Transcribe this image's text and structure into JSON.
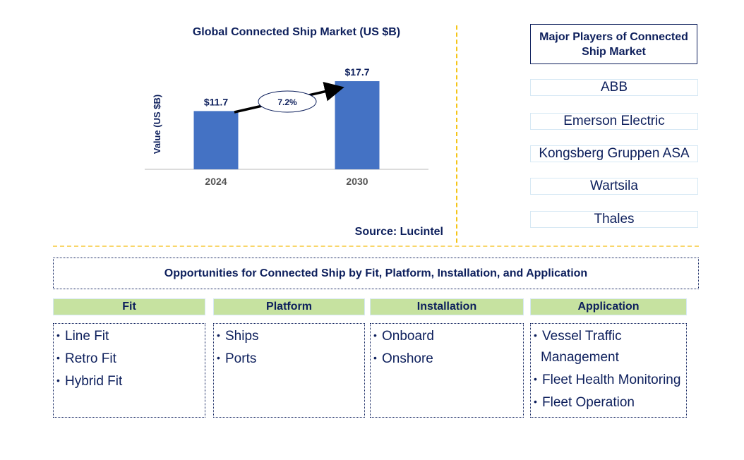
{
  "chart_data": {
    "type": "bar",
    "title": "Global Connected Ship Market (US $B)",
    "xlabel": "",
    "ylabel": "Value (US $B)",
    "categories": [
      "2024",
      "2030"
    ],
    "values": [
      11.7,
      17.7
    ],
    "data_labels": [
      "$11.7",
      "$17.7"
    ],
    "ylim": [
      0,
      20
    ],
    "grid": false,
    "bar_color": "#4472c4",
    "annotation": {
      "type": "cagr-arrow",
      "label": "7.2%",
      "from": "2024",
      "to": "2030"
    },
    "source": "Source: Lucintel"
  },
  "players": {
    "title": "Major Players of Connected Ship Market",
    "items": [
      "ABB",
      "Emerson Electric",
      "Kongsberg Gruppen ASA",
      "Wartsila",
      "Thales"
    ]
  },
  "opportunities": {
    "title": "Opportunities for Connected Ship by Fit, Platform, Installation, and Application",
    "categories": [
      {
        "name": "Fit",
        "items": [
          "Line Fit",
          "Retro Fit",
          "Hybrid Fit"
        ]
      },
      {
        "name": "Platform",
        "items": [
          "Ships",
          "Ports"
        ]
      },
      {
        "name": "Installation",
        "items": [
          "Onboard",
          "Onshore"
        ]
      },
      {
        "name": "Application",
        "items": [
          "Vessel Traffic",
          "Management",
          "Fleet Health Monitoring",
          "Fleet Operation"
        ]
      }
    ]
  },
  "colors": {
    "text": "#0d1f5c",
    "bar": "#4472c4",
    "header_fill": "#c6e2a0",
    "divider": "#f5c518"
  }
}
